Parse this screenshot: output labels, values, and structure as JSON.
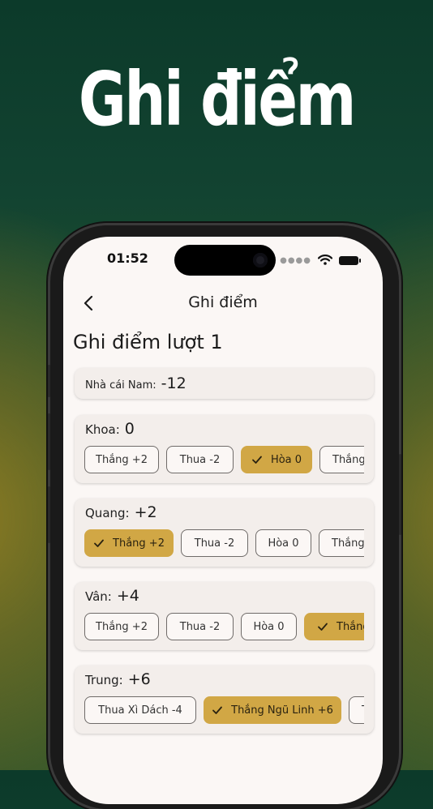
{
  "headline": "Ghi điểm",
  "status": {
    "time": "01:52"
  },
  "nav": {
    "title": "Ghi điểm"
  },
  "round_title": "Ghi điểm lượt 1",
  "dealer": {
    "label": "Nhà cái Nam:",
    "value": "-12"
  },
  "players": [
    {
      "name": "Khoa:",
      "score": "0",
      "options": [
        {
          "label": "Thắng +2",
          "selected": false
        },
        {
          "label": "Thua -2",
          "selected": false
        },
        {
          "label": "Hòa 0",
          "selected": true
        },
        {
          "label": "Thắng",
          "selected": false
        }
      ]
    },
    {
      "name": "Quang:",
      "score": "+2",
      "options": [
        {
          "label": "Thắng +2",
          "selected": true
        },
        {
          "label": "Thua -2",
          "selected": false
        },
        {
          "label": "Hòa 0",
          "selected": false
        },
        {
          "label": "Thắng",
          "selected": false
        }
      ]
    },
    {
      "name": "Vân:",
      "score": "+4",
      "options": [
        {
          "label": "Thắng +2",
          "selected": false
        },
        {
          "label": "Thua -2",
          "selected": false
        },
        {
          "label": "Hòa 0",
          "selected": false
        },
        {
          "label": "Thắng",
          "selected": true
        }
      ]
    },
    {
      "name": "Trung:",
      "score": "+6",
      "options": [
        {
          "label": "Thua Xì Dách -4",
          "selected": false
        },
        {
          "label": "Thắng Ngũ Linh +6",
          "selected": true
        },
        {
          "label": "T",
          "selected": false
        }
      ]
    }
  ],
  "colors": {
    "accent": "#d1a745",
    "bg": "#fbf7f5",
    "card": "#f3eeeb"
  }
}
